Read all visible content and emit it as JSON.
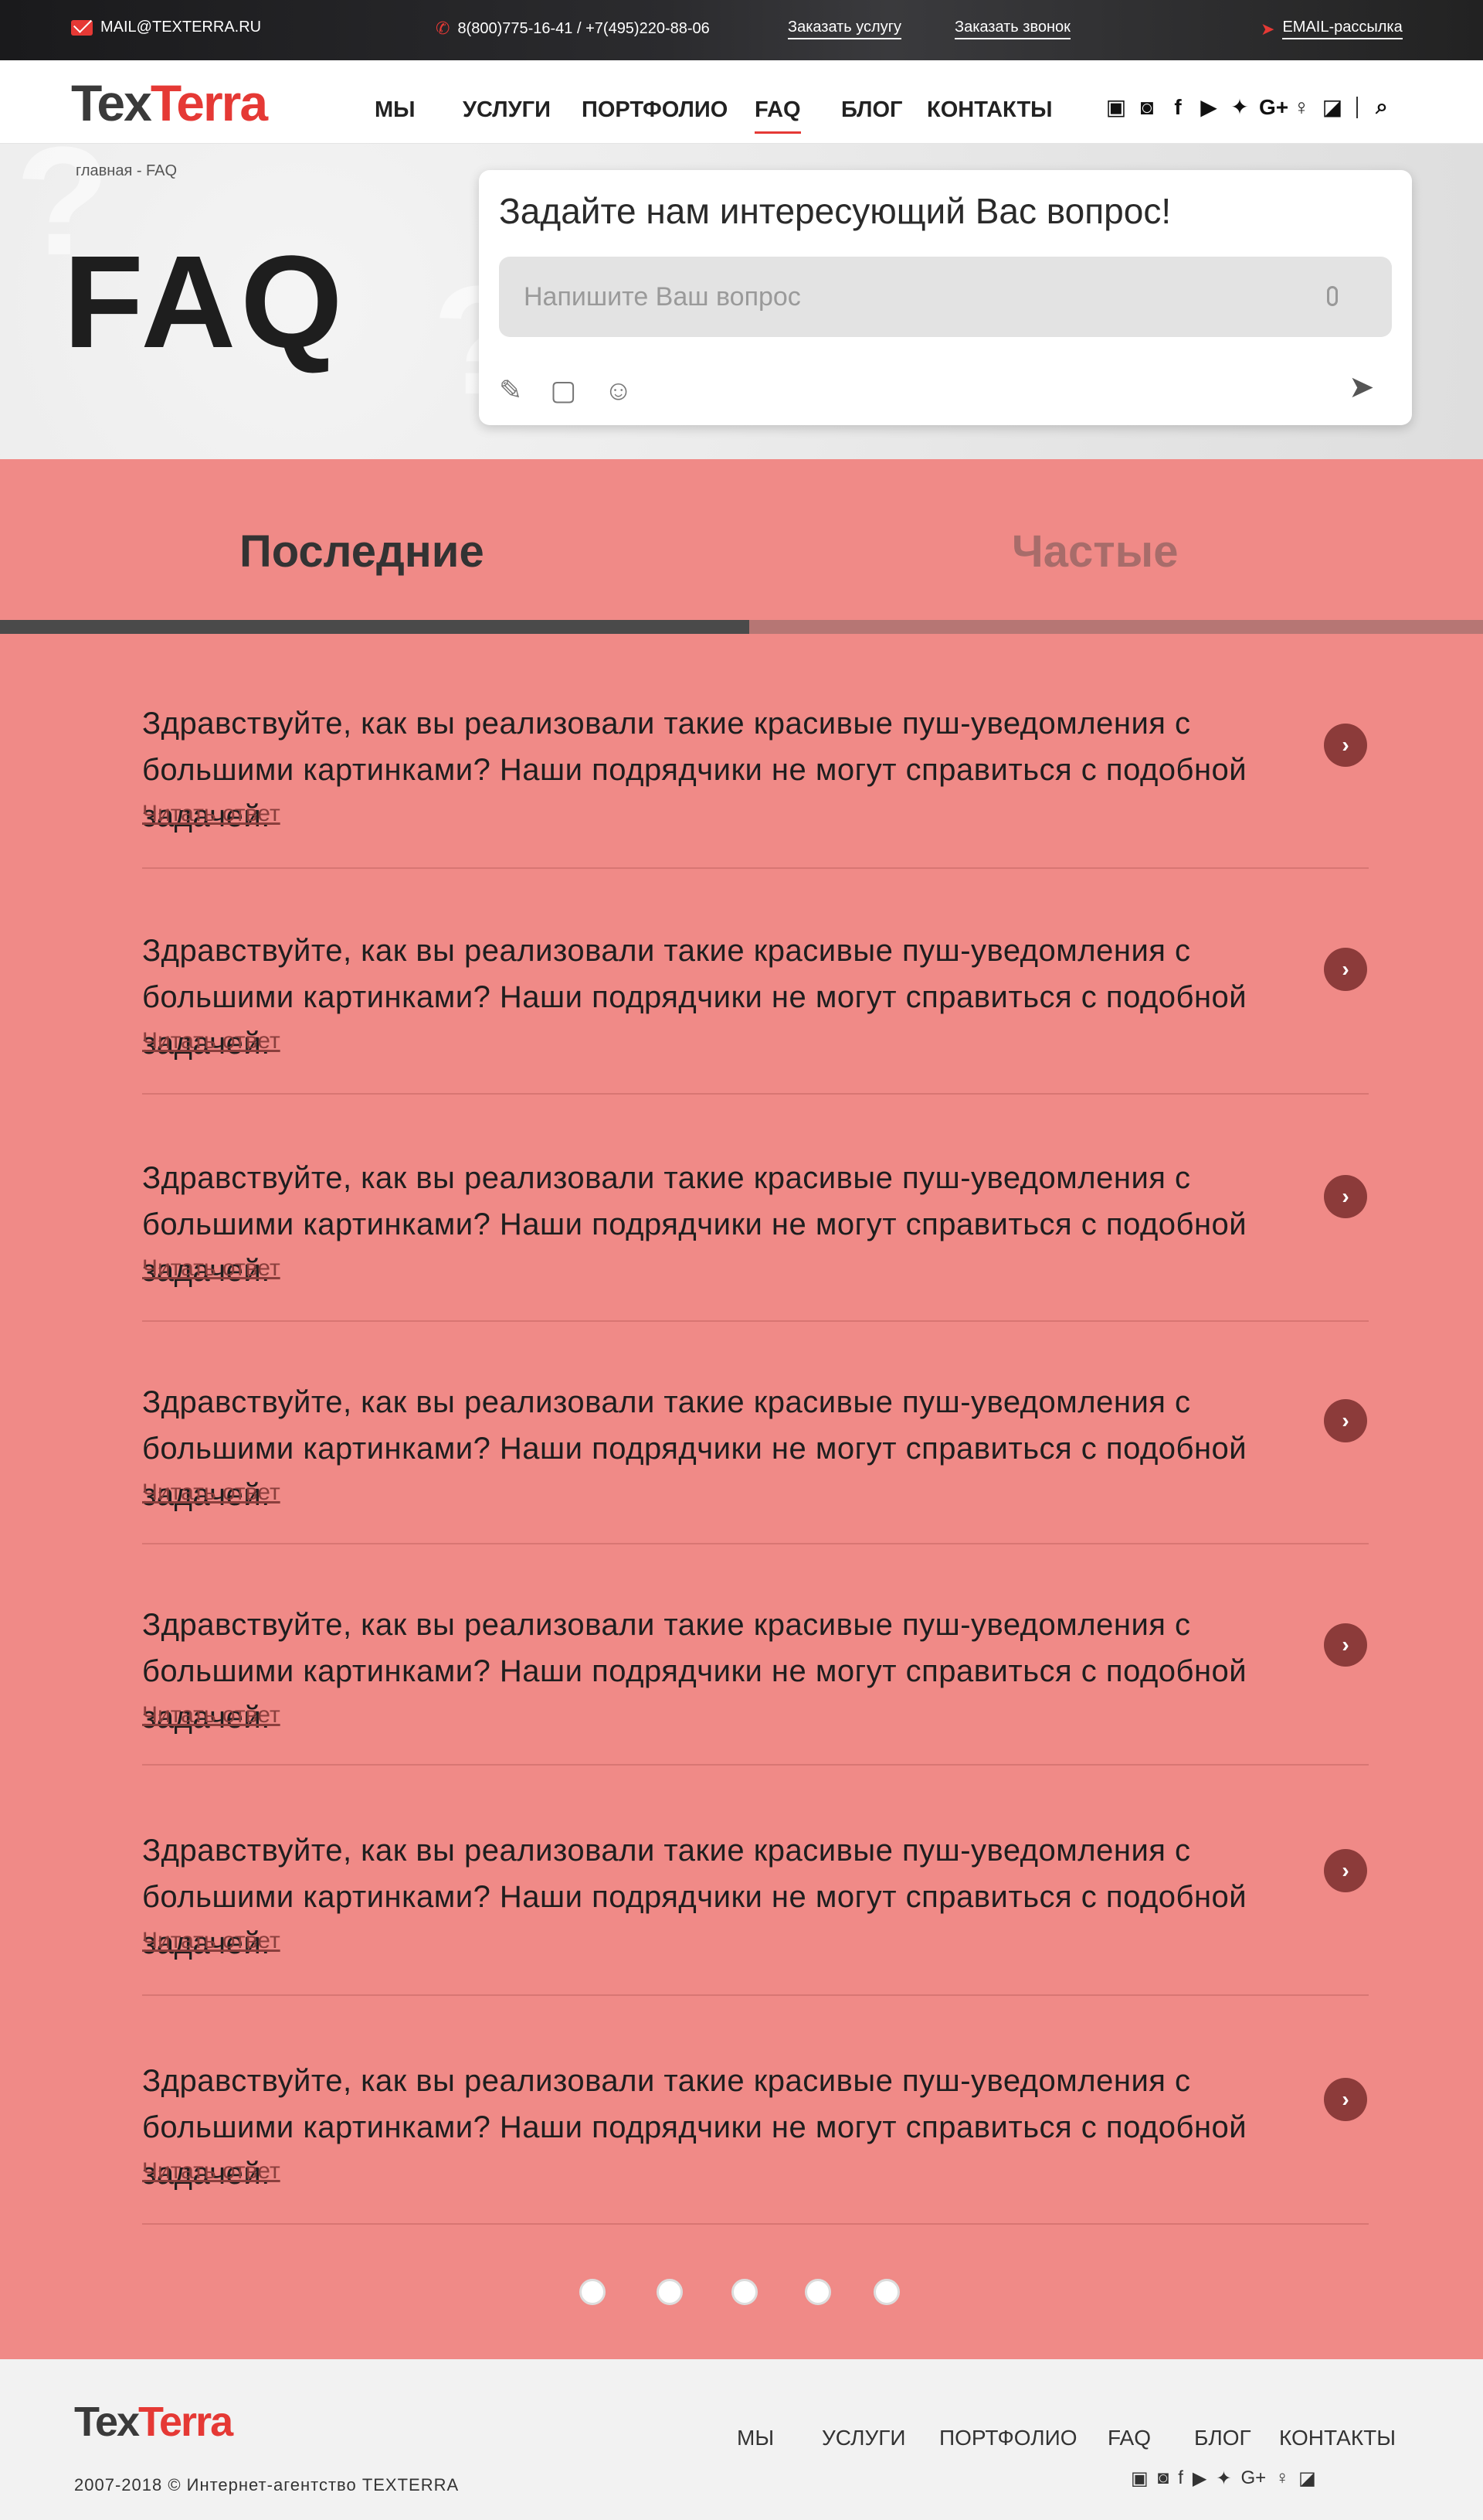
{
  "topbar": {
    "email": "MAIL@TEXTERRA.RU",
    "phones": "8(800)775-16-41 / +7(495)220-88-06",
    "order_service": "Заказать услугу",
    "order_call": "Заказать звонок",
    "newsletter": "EMAIL-рассылка"
  },
  "logo": {
    "part1": "Tex",
    "part2": "Terra"
  },
  "nav": [
    "МЫ",
    "УСЛУГИ",
    "ПОРТФОЛИО",
    "FAQ",
    "БЛОГ",
    "КОНТАКТЫ"
  ],
  "socials": [
    "vk-icon",
    "instagram-icon",
    "facebook-icon",
    "youtube-icon",
    "twitter-icon",
    "google-plus-icon",
    "odnoklassniki-icon",
    "rss-icon"
  ],
  "hero": {
    "breadcrumb": "главная - FAQ",
    "title": "FAQ",
    "ask_title": "Задайте нам интересующий Вас вопрос!",
    "ask_placeholder": "Напишите Ваш вопрос"
  },
  "tabs": {
    "latest": "Последние",
    "frequent": "Частые"
  },
  "questions": [
    {
      "text": "Здравствуйте, как вы реализовали такие красивые пуш-уведомления с большими картинками? Наши подрядчики не могут справиться с подобной задачей.",
      "link": "Читать ответ"
    },
    {
      "text": "Здравствуйте, как вы реализовали такие красивые пуш-уведомления с большими картинками? Наши подрядчики не могут справиться с подобной задачей.",
      "link": "Читать ответ"
    },
    {
      "text": "Здравствуйте, как вы реализовали такие красивые пуш-уведомления с большими картинками? Наши подрядчики не могут справиться с подобной задачей.",
      "link": "Читать ответ"
    },
    {
      "text": "Здравствуйте, как вы реализовали такие красивые пуш-уведомления с большими картинками? Наши подрядчики не могут справиться с подобной задачей.",
      "link": "Читать ответ"
    },
    {
      "text": "Здравствуйте, как вы реализовали такие красивые пуш-уведомления с большими картинками? Наши подрядчики не могут справиться с подобной задачей.",
      "link": "Читать ответ"
    },
    {
      "text": "Здравствуйте, как вы реализовали такие красивые пуш-уведомления с большими картинками? Наши подрядчики не могут справиться с подобной задачей.",
      "link": "Читать ответ"
    },
    {
      "text": "Здравствуйте, как вы реализовали такие красивые пуш-уведомления с большими картинками? Наши подрядчики не могут справиться с подобной задачей.",
      "link": "Читать ответ"
    }
  ],
  "footer": {
    "nav": [
      "МЫ",
      "УСЛУГИ",
      "ПОРТФОЛИО",
      "FAQ",
      "БЛОГ",
      "КОНТАКТЫ"
    ],
    "copyright": "2007-2018  © Интернет-агентство TEXTERRA"
  },
  "colors": {
    "accent": "#e53935",
    "page_bg": "#f08a87",
    "tab_active": "#4a4a4a"
  }
}
